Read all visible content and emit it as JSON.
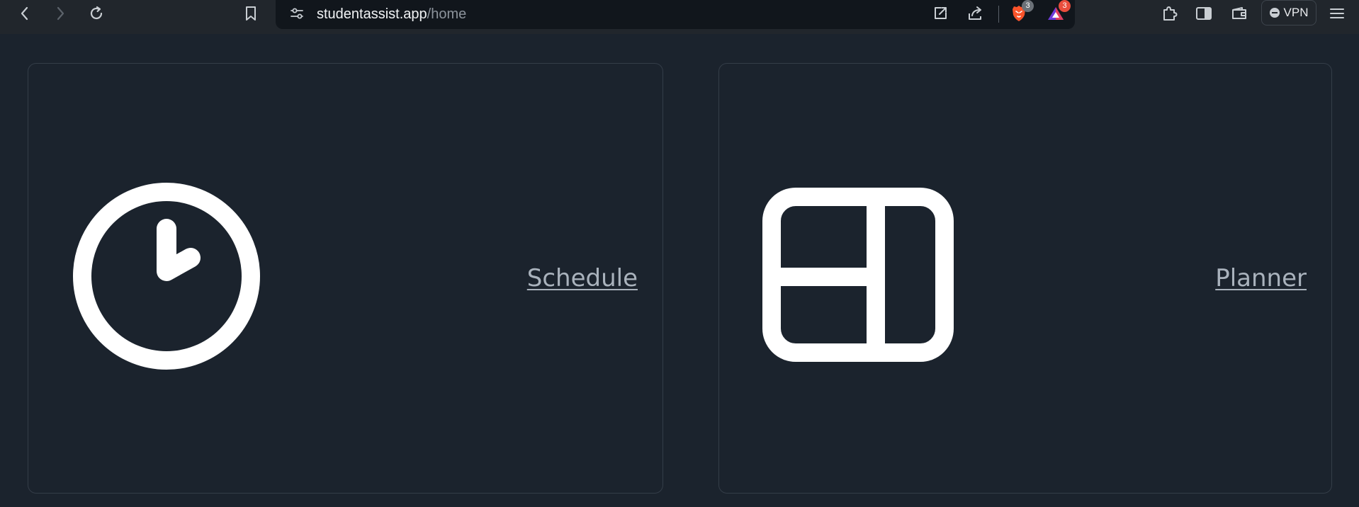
{
  "browser": {
    "url": {
      "domain": "studentassist.app",
      "path": "/home"
    },
    "shields_badge": "3",
    "rewards_badge": "3",
    "vpn_label": "VPN",
    "icons": {
      "back": "chevron-left-icon",
      "forward": "chevron-right-icon",
      "reload": "reload-icon",
      "bookmark": "bookmark-icon",
      "site_settings": "sliders-icon",
      "open_external": "open-external-icon",
      "share": "share-icon",
      "shields": "brave-lion-icon",
      "rewards": "brave-rewards-triangle-icon",
      "extensions": "puzzle-icon",
      "sidebar": "sidebar-icon",
      "wallet": "wallet-icon",
      "menu": "hamburger-menu-icon"
    },
    "colors": {
      "shields_orange": "#fb542b",
      "rewards_purple": "#6e3bd8",
      "badge_gray": "#6b7178",
      "badge_red": "#e94d3c"
    }
  },
  "cards": {
    "schedule": {
      "label": "Schedule",
      "icon": "clock-icon"
    },
    "planner": {
      "label": "Planner",
      "icon": "layout-panels-icon"
    }
  },
  "colors": {
    "page_bg": "#1b232d",
    "card_border": "#343d48",
    "link": "#a9b2bc",
    "icon": "#ffffff"
  }
}
